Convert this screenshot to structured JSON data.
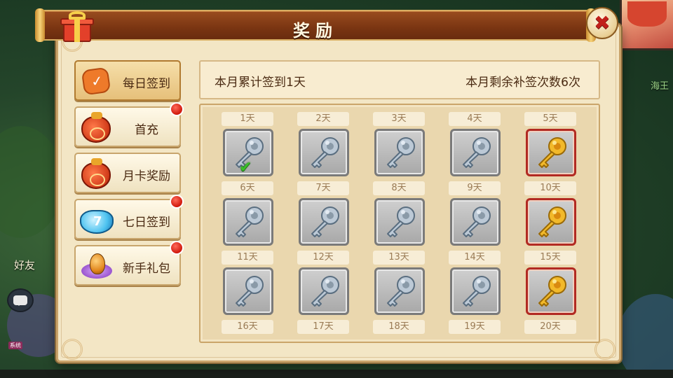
{
  "dialog": {
    "title": "奖励",
    "close_label": "✖"
  },
  "tabs": [
    {
      "label": "每日签到",
      "icon": "sign-in-icon",
      "active": true,
      "red_dot": false
    },
    {
      "label": "首充",
      "icon": "money-bag-icon",
      "active": false,
      "red_dot": true
    },
    {
      "label": "月卡奖励",
      "icon": "money-bag-icon",
      "active": false,
      "red_dot": false
    },
    {
      "label": "七日签到",
      "icon": "seven-bag-icon",
      "active": false,
      "red_dot": true
    },
    {
      "label": "新手礼包",
      "icon": "egg-icon",
      "active": false,
      "red_dot": true
    }
  ],
  "info": {
    "signed_text": "本月累计签到1天",
    "remaining_text": "本月剩余补签次数6次"
  },
  "days": [
    {
      "label": "1天",
      "key": "silver",
      "claimed": true
    },
    {
      "label": "2天",
      "key": "silver",
      "claimed": false
    },
    {
      "label": "3天",
      "key": "silver",
      "claimed": false
    },
    {
      "label": "4天",
      "key": "silver",
      "claimed": false
    },
    {
      "label": "5天",
      "key": "gold",
      "claimed": false
    },
    {
      "label": "6天",
      "key": "silver",
      "claimed": false
    },
    {
      "label": "7天",
      "key": "silver",
      "claimed": false
    },
    {
      "label": "8天",
      "key": "silver",
      "claimed": false
    },
    {
      "label": "9天",
      "key": "silver",
      "claimed": false
    },
    {
      "label": "10天",
      "key": "gold",
      "claimed": false
    },
    {
      "label": "11天",
      "key": "silver",
      "claimed": false
    },
    {
      "label": "12天",
      "key": "silver",
      "claimed": false
    },
    {
      "label": "13天",
      "key": "silver",
      "claimed": false
    },
    {
      "label": "14天",
      "key": "silver",
      "claimed": false
    },
    {
      "label": "15天",
      "key": "gold",
      "claimed": false
    },
    {
      "label": "16天"
    },
    {
      "label": "17天"
    },
    {
      "label": "18天"
    },
    {
      "label": "19天"
    },
    {
      "label": "20天"
    }
  ],
  "background": {
    "friend_label": "好友",
    "side_text": "海王",
    "chat_tag": "系统"
  },
  "colors": {
    "title_bar": "#7a3512",
    "panel": "#f3e6c5",
    "red_dot": "#d0180c",
    "gold_border": "#b22a22",
    "check": "#3bbd2a"
  }
}
